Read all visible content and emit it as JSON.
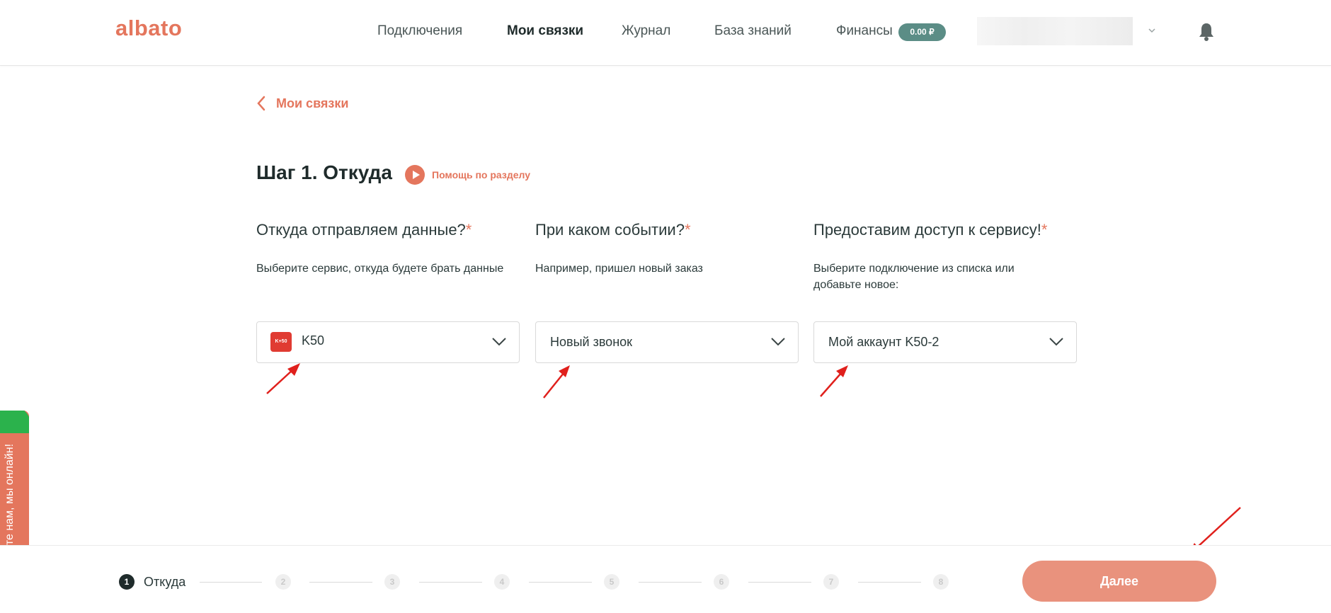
{
  "header": {
    "logo": "albato",
    "nav": [
      {
        "label": "Подключения",
        "active": false
      },
      {
        "label": "Мои связки",
        "active": true
      },
      {
        "label": "Журнал",
        "active": false
      },
      {
        "label": "База знаний",
        "active": false
      },
      {
        "label": "Финансы",
        "active": false
      }
    ],
    "balance_badge": "0.00 ₽",
    "icons": {
      "user_menu": "chevron-down-icon",
      "notifications": "bell-icon"
    }
  },
  "back_link": {
    "label": "Мои связки",
    "icon": "chevron-left-icon"
  },
  "step": {
    "title": "Шаг 1. Откуда",
    "help_label": "Помощь по разделу",
    "help_icon": "play-icon"
  },
  "columns": [
    {
      "title": "Откуда отправляем данные?",
      "required_mark": "*",
      "hint": "Выберите сервис, откуда будете брать данные",
      "select_value": "K50",
      "service_icon_text": "K+50"
    },
    {
      "title": "При каком событии?",
      "required_mark": "*",
      "hint": "Например, пришел новый заказ",
      "select_value": "Новый звонок"
    },
    {
      "title": "Предоставим доступ к сервису!",
      "required_mark": "*",
      "hint": "Выберите подключение из списка или добавьте новое:",
      "select_value": "Мой аккаунт K50-2"
    }
  ],
  "chat_widget": {
    "label": "Напишите нам, мы онлайн!"
  },
  "footer": {
    "steps": [
      "1",
      "2",
      "3",
      "4",
      "5",
      "6",
      "7",
      "8"
    ],
    "active_step": 1,
    "active_label": "Откуда",
    "next_button": "Далее"
  },
  "colors": {
    "accent": "#e4765d",
    "next_button": "#e9927d",
    "badge": "#5b8d86",
    "annotation_arrow": "#e0201c",
    "chat_green": "#2bb24c"
  }
}
